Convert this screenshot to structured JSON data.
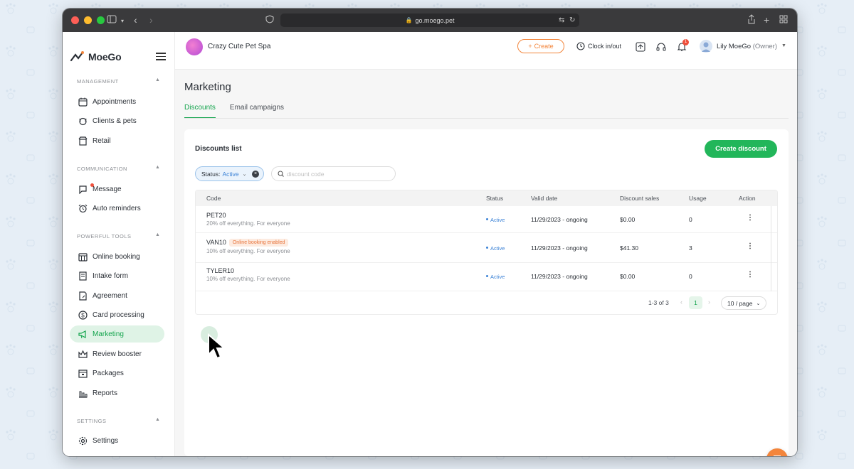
{
  "browser": {
    "url": "go.moego.pet"
  },
  "sidebar": {
    "logo_text": "MoeGo",
    "sections": [
      {
        "title": "MANAGEMENT",
        "items": [
          {
            "label": "Appointments",
            "icon": "calendar-icon"
          },
          {
            "label": "Clients & pets",
            "icon": "dog-face-icon"
          },
          {
            "label": "Retail",
            "icon": "shop-icon"
          }
        ]
      },
      {
        "title": "COMMUNICATION",
        "items": [
          {
            "label": "Message",
            "icon": "chat-bubble-icon"
          },
          {
            "label": "Auto reminders",
            "icon": "alarm-clock-icon"
          }
        ]
      },
      {
        "title": "POWERFUL TOOLS",
        "items": [
          {
            "label": "Online booking",
            "icon": "calendar-grid-icon"
          },
          {
            "label": "Intake form",
            "icon": "form-icon"
          },
          {
            "label": "Agreement",
            "icon": "agreement-icon"
          },
          {
            "label": "Card processing",
            "icon": "dollar-icon"
          },
          {
            "label": "Marketing",
            "icon": "megaphone-icon"
          },
          {
            "label": "Review booster",
            "icon": "crown-icon"
          },
          {
            "label": "Packages",
            "icon": "package-icon"
          },
          {
            "label": "Reports",
            "icon": "bar-chart-icon"
          }
        ]
      },
      {
        "title": "SETTINGS",
        "items": [
          {
            "label": "Settings",
            "icon": "gear-icon"
          }
        ]
      }
    ],
    "active_item": "Marketing"
  },
  "topbar": {
    "business_name": "Crazy Cute Pet Spa",
    "create_label": "Create",
    "clock_label": "Clock in/out",
    "notification_count": "1",
    "user_name": "Lily MoeGo",
    "user_role": "(Owner)"
  },
  "page": {
    "title": "Marketing",
    "tabs": [
      {
        "label": "Discounts",
        "active": true
      },
      {
        "label": "Email campaigns",
        "active": false
      }
    ]
  },
  "discounts": {
    "list_title": "Discounts list",
    "create_button": "Create discount",
    "filter": {
      "label": "Status:",
      "value": "Active"
    },
    "search_placeholder": "discount code",
    "columns": [
      "Code",
      "Status",
      "Valid date",
      "Discount sales",
      "Usage",
      "Action"
    ],
    "rows": [
      {
        "code": "PET20",
        "badge": "",
        "description": "20% off everything. For everyone",
        "status": "Active",
        "valid_date": "11/29/2023 - ongoing",
        "sales": "$0.00",
        "usage": "0"
      },
      {
        "code": "VAN10",
        "badge": "Online booking enabled",
        "description": "10% off everything. For everyone",
        "status": "Active",
        "valid_date": "11/29/2023 - ongoing",
        "sales": "$41.30",
        "usage": "3"
      },
      {
        "code": "TYLER10",
        "badge": "",
        "description": "10% off everything. For everyone",
        "status": "Active",
        "valid_date": "11/29/2023 - ongoing",
        "sales": "$0.00",
        "usage": "0"
      }
    ],
    "pagination": {
      "range": "1-3 of 3",
      "current_page": "1",
      "page_size": "10 / page"
    }
  },
  "colors": {
    "brand_green": "#22b65a",
    "accent_orange": "#f3853b",
    "link_blue": "#3b82d6"
  }
}
